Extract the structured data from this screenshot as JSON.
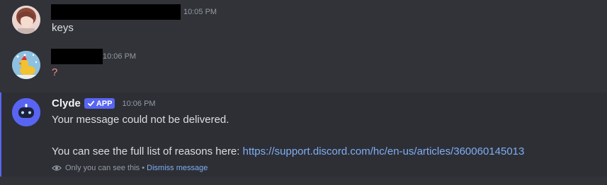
{
  "messages": [
    {
      "timestamp": "10:05 PM",
      "text": "keys"
    },
    {
      "timestamp": "10:06 PM",
      "text": "?"
    },
    {
      "author": "Clyde",
      "badge": "APP",
      "timestamp": "10:06 PM",
      "line1": "Your message could not be delivered.",
      "line2_prefix": "You can see the full list of reasons here: ",
      "link": "https://support.discord.com/hc/en-us/articles/360060145013",
      "ephemeral_note": "Only you can see this",
      "separator": " • ",
      "dismiss": "Dismiss message"
    }
  ],
  "colors": {
    "background": "#313338",
    "highlight_bg": "#2e2f35",
    "accent": "#5865f2",
    "link": "#7eaef5"
  }
}
